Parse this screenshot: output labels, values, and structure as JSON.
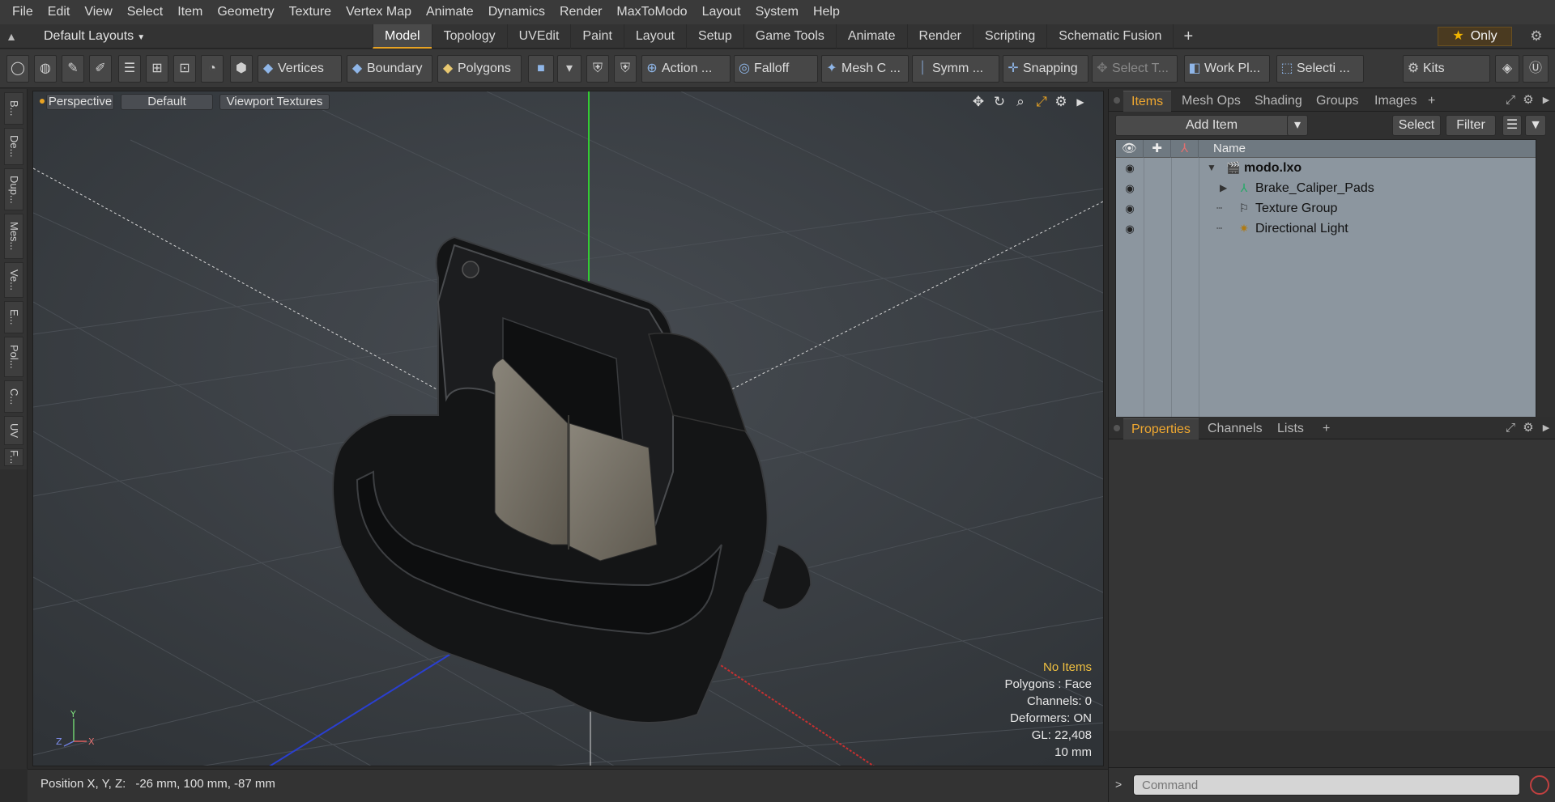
{
  "menu": [
    "File",
    "Edit",
    "View",
    "Select",
    "Item",
    "Geometry",
    "Texture",
    "Vertex Map",
    "Animate",
    "Dynamics",
    "Render",
    "MaxToModo",
    "Layout",
    "System",
    "Help"
  ],
  "layout": {
    "label": "Default Layouts"
  },
  "tabs": [
    "Model",
    "Topology",
    "UVEdit",
    "Paint",
    "Layout",
    "Setup",
    "Game Tools",
    "Animate",
    "Render",
    "Scripting",
    "Schematic Fusion"
  ],
  "tabs_active": "Model",
  "tabs_plus": "+",
  "only_label": "Only",
  "toolbar": {
    "vertices": "Vertices",
    "boundary": "Boundary",
    "polygons": "Polygons",
    "action": "Action",
    "action_more": "...",
    "falloff": "Falloff",
    "mesh": "Mesh C ...",
    "symm": "Symm ...",
    "snapping": "Snapping",
    "select_t": "Select T...",
    "work_pl": "Work Pl...",
    "selecti": "Selecti ...",
    "kits": "Kits"
  },
  "left_tabs": [
    "B...",
    "De...",
    "Dup...",
    "Mes...",
    "Ve...",
    "E...",
    "Pol...",
    "C...",
    "UV",
    "F..."
  ],
  "viewport": {
    "view": "Perspective",
    "shading": "Default",
    "textures": "Viewport Textures",
    "gizmo": {
      "y": "Y",
      "x": "X",
      "z": "Z"
    },
    "info": {
      "no_items": "No Items",
      "polygons": "Polygons : Face",
      "channels": "Channels: 0",
      "deformers": "Deformers: ON",
      "gl": "GL: 22,408",
      "scale": "10 mm"
    }
  },
  "status": {
    "label": "Position X, Y, Z:",
    "value": "-26 mm, 100 mm, -87 mm"
  },
  "items_panel": {
    "tabs": [
      "Items",
      "Mesh Ops",
      "Shading",
      "Groups",
      "Images"
    ],
    "active": "Items",
    "plus": "+",
    "add_item": "Add Item",
    "select": "Select",
    "filter": "Filter",
    "col_name": "Name",
    "rows": [
      {
        "name": "modo.lxo",
        "bold": true
      },
      {
        "name": "Brake_Caliper_Pads"
      },
      {
        "name": "Texture Group"
      },
      {
        "name": "Directional Light"
      }
    ]
  },
  "props_panel": {
    "tabs": [
      "Properties",
      "Channels",
      "Lists"
    ],
    "active": "Properties",
    "plus": "+"
  },
  "command": {
    "placeholder": "Command",
    "prompt": ">"
  },
  "colors": {
    "accent": "#e8a323",
    "viewport_bg": "#383c40",
    "tree_bg": "#8c969f"
  }
}
